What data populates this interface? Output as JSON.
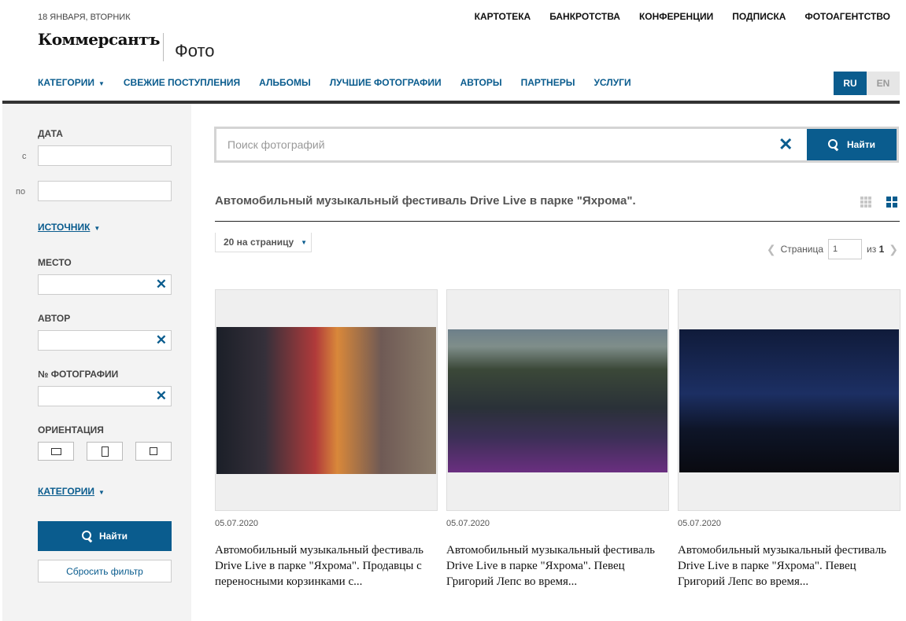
{
  "header": {
    "date": "18 ЯНВАРЯ, ВТОРНИК",
    "top_nav": [
      "КАРТОТЕКА",
      "БАНКРОТСТВА",
      "КОНФЕРЕНЦИИ",
      "ПОДПИСКА",
      "ФОТОАГЕНТСТВО"
    ],
    "logo": "Коммерсантъ",
    "section": "Фото",
    "main_nav": {
      "categories": "КАТЕГОРИИ",
      "items": [
        "СВЕЖИЕ ПОСТУПЛЕНИЯ",
        "АЛЬБОМЫ",
        "ЛУЧШИЕ ФОТОГРАФИИ",
        "АВТОРЫ",
        "ПАРТНЕРЫ",
        "УСЛУГИ"
      ]
    },
    "lang": {
      "active": "RU",
      "inactive": "EN"
    }
  },
  "sidebar": {
    "date_label": "ДАТА",
    "from_label": "с",
    "to_label": "по",
    "source_link": "ИСТОЧНИК",
    "place_label": "МЕСТО",
    "author_label": "АВТОР",
    "photo_no_label": "№ ФОТОГРАФИИ",
    "orientation_label": "ОРИЕНТАЦИЯ",
    "categories_link": "КАТЕГОРИИ",
    "search_button": "Найти",
    "reset_button": "Сбросить фильтр",
    "clear_glyph": "✕"
  },
  "search": {
    "placeholder": "Поиск фотографий",
    "button": "Найти",
    "clear_glyph": "✕"
  },
  "album": {
    "title": "Автомобильный музыкальный фестиваль Drive Live в парке \"Яхрома\"."
  },
  "pagination": {
    "per_page": "20 на страницу",
    "page_label": "Страница",
    "page_value": "1",
    "of_label": "из",
    "total": "1"
  },
  "photos": [
    {
      "date": "05.07.2020",
      "caption": "Автомобильный музыкальный фестиваль Drive Live в парке \"Яхрома\". Продавцы с переносными корзинками с..."
    },
    {
      "date": "05.07.2020",
      "caption": "Автомобильный музыкальный фестиваль Drive Live в парке \"Яхрома\". Певец Григорий Лепс во время..."
    },
    {
      "date": "05.07.2020",
      "caption": "Автомобильный музыкальный фестиваль Drive Live в парке \"Яхрома\". Певец Григорий Лепс во время..."
    }
  ],
  "colors": {
    "accent": "#0a5c8e",
    "sidebar_bg": "#f3f3f3",
    "header_rule": "#333333"
  }
}
